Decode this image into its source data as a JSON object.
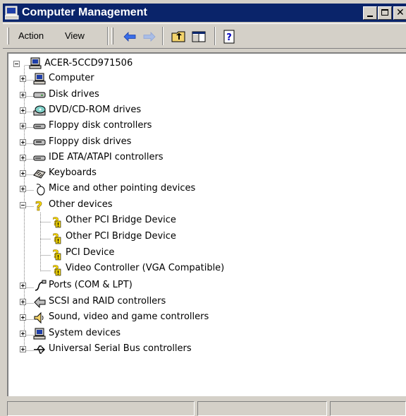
{
  "window": {
    "title": "Computer Management"
  },
  "menu": {
    "action": "Action",
    "view": "View"
  },
  "toolbar": {
    "icons": [
      "back-arrow-icon",
      "forward-arrow-icon",
      "up-folder-icon",
      "show-hide-tree-icon",
      "help-icon"
    ]
  },
  "tree": {
    "root": "ACER-5CCD971506",
    "items": [
      "Computer",
      "Disk drives",
      "DVD/CD-ROM drives",
      "Floppy disk controllers",
      "Floppy disk drives",
      "IDE ATA/ATAPI controllers",
      "Keyboards",
      "Mice and other pointing devices",
      "Other devices",
      "Other PCI Bridge Device",
      "Other PCI Bridge Device",
      "PCI Device",
      "Video Controller (VGA Compatible)",
      "Ports (COM & LPT)",
      "SCSI and RAID controllers",
      "Sound, video and game controllers",
      "System devices",
      "Universal Serial Bus controllers"
    ]
  },
  "colors": {
    "titlebar": "#0a246a",
    "face": "#d4d0c8",
    "warning": "#f5d800"
  }
}
